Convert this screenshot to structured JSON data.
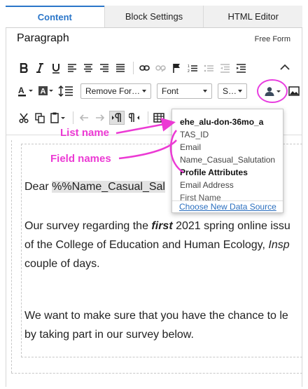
{
  "tabs": [
    {
      "label": "Content"
    },
    {
      "label": "Block Settings"
    },
    {
      "label": "HTML Editor"
    }
  ],
  "block": {
    "type": "Paragraph",
    "mode": "Free Form"
  },
  "toolbar": {
    "remove_format": "Remove For…",
    "font": "Font",
    "size": "S…"
  },
  "editor": {
    "greeting_prefix": "Dear ",
    "merge_token": "%%Name_Casual_Sal",
    "p1_line1_a": "Our survey regarding the ",
    "p1_line1_em": "first",
    "p1_line1_b": " 2021 spring online issu",
    "p1_line2_a": "of the College of Education and Human Ecology, ",
    "p1_line2_em": "Insp",
    "p1_line3": "couple of days.",
    "p2_line1": "We want to make sure that you have the chance to le",
    "p2_line2": "by taking part in our survey below."
  },
  "dropdown": {
    "list_name": "ehe_alu-don-36mo_a",
    "fields": [
      "TAS_ID",
      "Email",
      "Name_Casual_Salutation"
    ],
    "section_header": "Profile Attributes",
    "profile_fields": [
      "Email Address",
      "First Name"
    ],
    "footer_link": "Choose New Data Source"
  },
  "annotations": {
    "list_name": "List name",
    "field_names": "Field names"
  },
  "colors": {
    "accent": "#2b76c9",
    "annotation": "#ec3ad4",
    "link": "#2b6fbf"
  }
}
